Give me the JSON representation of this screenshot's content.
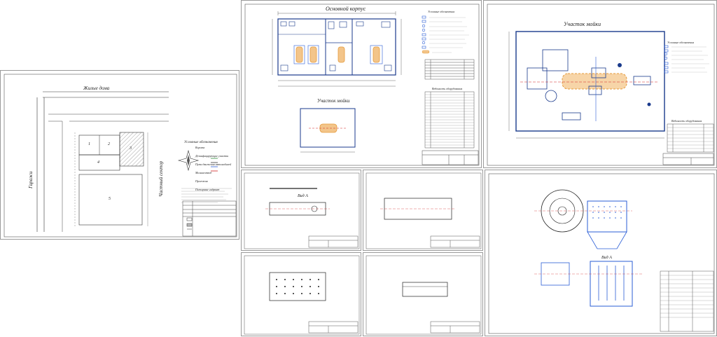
{
  "colors": {
    "line": "#1a3a8c",
    "blue": "#2a5dd6",
    "orange": "#e59a3a",
    "red": "#d02020",
    "green": "#2d8a3a",
    "hatch": "#555555"
  },
  "sheet1": {
    "road_top": "Жилые дома",
    "road_left": "Гаражи",
    "road_right": "Частный сектор",
    "legend_title": "Условные обозначения",
    "legend": [
      "Ворота",
      "Дезинфицирующие участки",
      "Пути движения автомобилей",
      "Молниеотвод",
      "Проезжая",
      "Пожарные гидрант"
    ],
    "zone_nums": [
      "1",
      "2",
      "3",
      "4",
      "5"
    ]
  },
  "sheet2": {
    "title_main": "Основной корпус",
    "title_wash": "Участок мойки",
    "legend_title": "Условные обозначения",
    "equip_title": "Ведомость оборудования"
  },
  "sheet3": {
    "title": "Участок мойки",
    "legend_title": "Условные обозначения",
    "equip_title": "Ведомость оборудования"
  },
  "sheet_parts": {
    "view_a": "Вид А",
    "view_a2": "Вид А"
  }
}
